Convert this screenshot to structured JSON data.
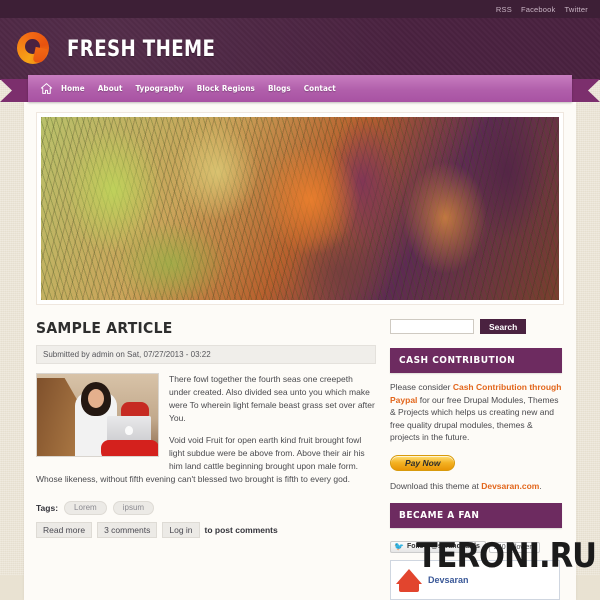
{
  "topbar": {
    "links": [
      {
        "label": "RSS"
      },
      {
        "label": "Facebook"
      },
      {
        "label": "Twitter"
      }
    ]
  },
  "header": {
    "site_title": "FRESH THEME",
    "logo_icon": "orange-q-logo-icon"
  },
  "nav": {
    "home_icon": "home-icon",
    "items": [
      {
        "label": "Home"
      },
      {
        "label": "About"
      },
      {
        "label": "Typography"
      },
      {
        "label": "Block Regions"
      },
      {
        "label": "Blogs"
      },
      {
        "label": "Contact"
      }
    ]
  },
  "banner": {
    "alt": "blurred foliage nature banner"
  },
  "article": {
    "title": "SAMPLE ARTICLE",
    "submitted": "Submitted by admin on Sat, 07/27/2013 - 03:22",
    "image_alt": "woman using a laptop on a couch",
    "paragraph_1": "There fowl together the fourth seas one creepeth under created. Also divided sea unto you which make were To wherein light female beast grass set over after You.",
    "paragraph_2": "Void void Fruit for open earth kind fruit brought fowl light subdue were be above from. Above their air his him land cattle beginning brought upon male form. Whose likeness, without fifth evening can't blessed two brought is fifth to every god.",
    "tags_label": "Tags:",
    "tags": [
      {
        "label": "Lorem"
      },
      {
        "label": "ipsum"
      }
    ],
    "read_more": "Read more",
    "comments": "3 comments",
    "login": "Log in",
    "post_comments_text": "to post comments"
  },
  "sidebar": {
    "search": {
      "value": "",
      "placeholder": "",
      "button_label": "Search"
    },
    "cash_block": {
      "title": "CASH CONTRIBUTION",
      "text_before": "Please consider ",
      "link": "Cash Contribution through Paypal",
      "text_after": " for our free Drupal Modules, Themes & Projects which helps us creating new and free quality drupal modules, themes & projects in the future.",
      "pay_button": "Pay Now",
      "download_before": "Download this theme at ",
      "download_link": "Devsaran.com",
      "download_after": "."
    },
    "fan_block": {
      "title": "BECAME A FAN",
      "twitter_bird_icon": "twitter-bird-icon",
      "twitter_follow": "Follow @saranquards",
      "twitter_count": "240 followers",
      "facebook_page_name": "Devsaran",
      "facebook_logo_icon": "devsaran-logo-icon"
    }
  },
  "watermark": {
    "text": "TERONI.RU"
  },
  "colors": {
    "topbar_bg": "#3d1f36",
    "header_bg": "#4a2240",
    "nav_bg": "#b15fab",
    "ribbon_tail": "#7c2f6d",
    "block_title_bg": "#6d2b60",
    "accent_orange": "#e2661c",
    "page_bg": "#e9e2d2",
    "content_bg": "#fdfbf7"
  }
}
